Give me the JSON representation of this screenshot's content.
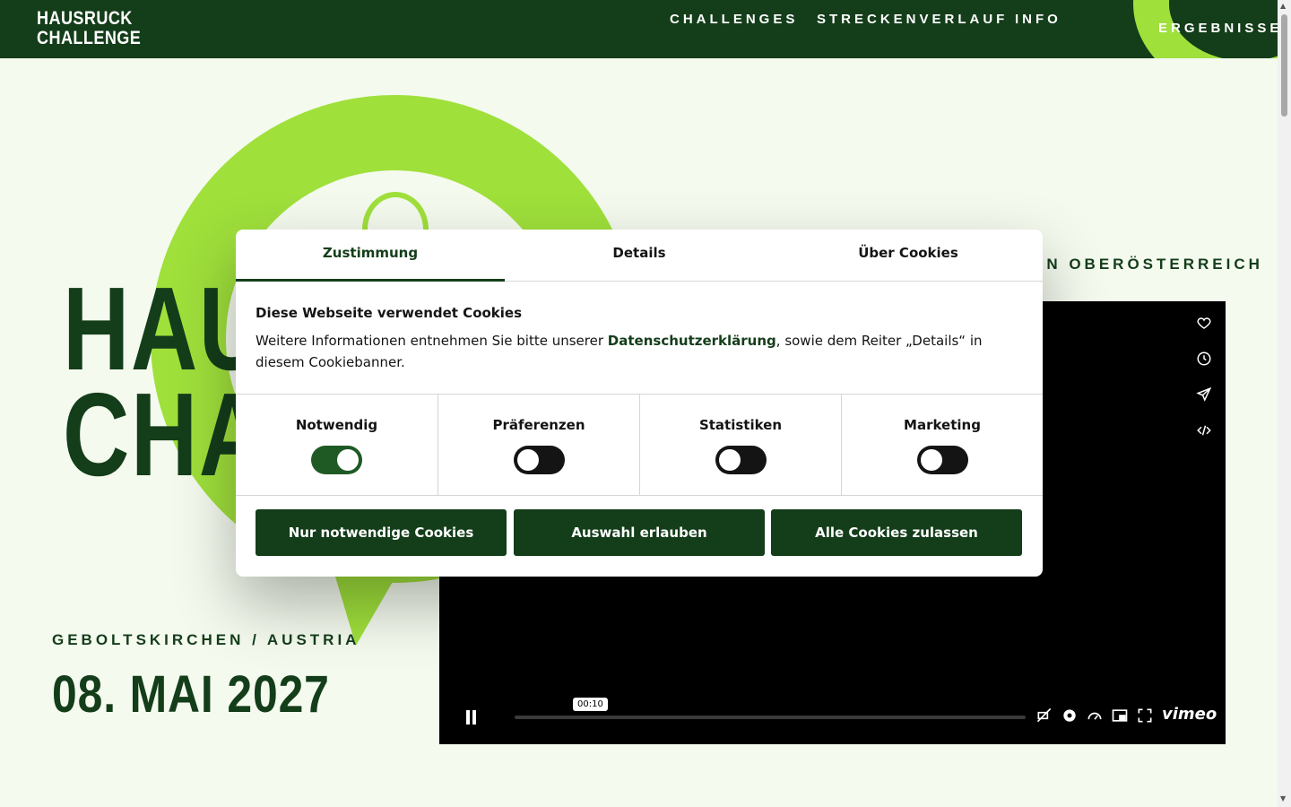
{
  "header": {
    "logo_line1": "HAUSRUCK",
    "logo_line2": "CHALLENGE",
    "nav": [
      "CHALLENGES",
      "STRECKENVERLAUF",
      "INFO",
      "ERGEBNISSE"
    ]
  },
  "hero": {
    "title_line1": "HAUSRUCK",
    "title_line2": "CHALLENGE",
    "subline": "EN OBERÖSTERREICH",
    "location": "GEBOLTSKIRCHEN / AUSTRIA",
    "date": "08. MAI 2027"
  },
  "video": {
    "time_tooltip": "00:10",
    "brand": "vimeo",
    "side_icons": [
      "heart-icon",
      "clock-icon",
      "send-icon",
      "embed-icon"
    ],
    "control_icons": [
      "captions-off-icon",
      "settings-icon",
      "speed-icon",
      "pip-icon",
      "fullscreen-icon"
    ]
  },
  "cookie": {
    "tabs": [
      "Zustimmung",
      "Details",
      "Über Cookies"
    ],
    "active_tab": "Zustimmung",
    "heading": "Diese Webseite verwendet Cookies",
    "text_before": "Weitere Informationen entnehmen Sie bitte unserer ",
    "link": "Datenschutzerklärung",
    "text_after": ", sowie dem Reiter „Details“ in diesem Cookiebanner.",
    "toggles": [
      {
        "label": "Notwendig",
        "on": true
      },
      {
        "label": "Präferenzen",
        "on": false
      },
      {
        "label": "Statistiken",
        "on": false
      },
      {
        "label": "Marketing",
        "on": false
      }
    ],
    "buttons": [
      "Nur notwendige Cookies",
      "Auswahl erlauben",
      "Alle Cookies zulassen"
    ]
  },
  "colors": {
    "dark_green": "#143d1a",
    "lime": "#9fe03b",
    "background": "#f4faee"
  }
}
